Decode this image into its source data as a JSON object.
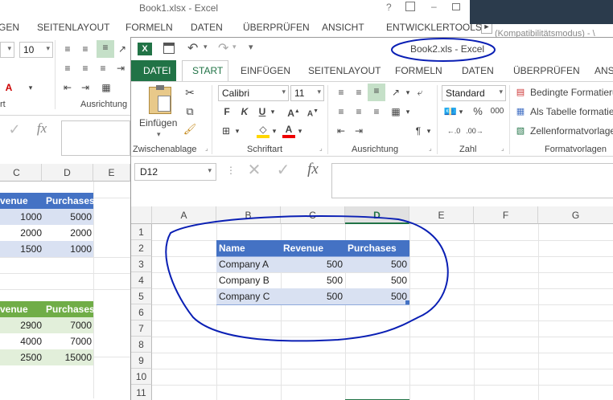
{
  "back": {
    "title": "Book1.xlsx - Excel",
    "tabs": [
      "GEN",
      "SEITENLAYOUT",
      "FORMELN",
      "DATEN",
      "ÜBERPRÜFEN",
      "ANSICHT",
      "ENTWICKLERTOOLS"
    ],
    "font_size": "10",
    "groups": [
      "rt",
      "Ausrichtung"
    ],
    "compat": "(Kompatibilitätsmodus) - \\",
    "col_headers": [
      "C",
      "D",
      "E"
    ],
    "table1": {
      "headers": [
        "venue",
        "Purchases"
      ],
      "rows": [
        [
          "1000",
          "5000"
        ],
        [
          "2000",
          "2000"
        ],
        [
          "1500",
          "1000"
        ]
      ]
    },
    "table2": {
      "headers": [
        "venue",
        "Purchases"
      ],
      "rows": [
        [
          "2900",
          "7000"
        ],
        [
          "4000",
          "7000"
        ],
        [
          "2500",
          "15000"
        ]
      ]
    }
  },
  "front": {
    "title": "Book2.xls - Excel",
    "tabs": {
      "datei": "DATEI",
      "start": "START",
      "others": [
        "EINFÜGEN",
        "SEITENLAYOUT",
        "FORMELN",
        "DATEN",
        "ÜBERPRÜFEN",
        "ANS"
      ]
    },
    "ribbon": {
      "paste_label": "Einfügen",
      "font_name": "Calibri",
      "font_size": "11",
      "number_format": "Standard",
      "styles": [
        "Bedingte Formatierung",
        "Als Tabelle formatieren",
        "Zellenformatvorlagen"
      ],
      "groups": [
        "Zwischenablage",
        "Schriftart",
        "Ausrichtung",
        "Zahl",
        "Formatvorlagen"
      ],
      "bold": "F",
      "italic": "K",
      "underline": "U",
      "percent": "%",
      "thousands": "000"
    },
    "name_box": "D12",
    "col_headers": [
      "A",
      "B",
      "C",
      "D",
      "E",
      "F",
      "G"
    ],
    "row_headers": [
      "1",
      "2",
      "3",
      "4",
      "5",
      "6",
      "7",
      "8",
      "9",
      "10",
      "11"
    ],
    "table": {
      "headers": [
        "Name",
        "Revenue",
        "Purchases"
      ],
      "rows": [
        [
          "Company A",
          "500",
          "500"
        ],
        [
          "Company B",
          "500",
          "500"
        ],
        [
          "Company C",
          "500",
          "500"
        ]
      ]
    },
    "annotation_color": "#0a1fb4",
    "accent": "#217346",
    "table_header_color": "#4472c4",
    "table_band_color": "#d9e1f2"
  }
}
